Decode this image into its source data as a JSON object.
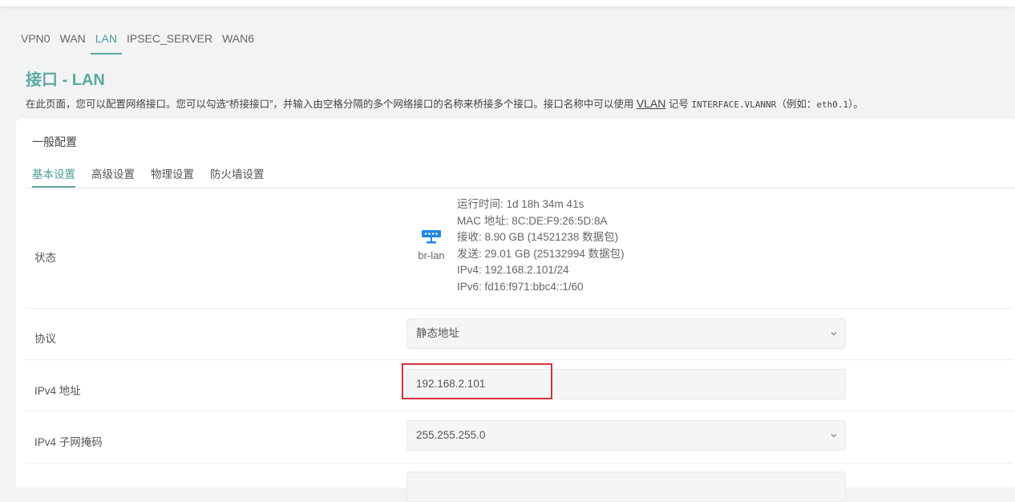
{
  "top_tabs": [
    "VPN0",
    "WAN",
    "LAN",
    "IPSEC_SERVER",
    "WAN6"
  ],
  "active_tab": "LAN",
  "page": {
    "title": "接口 - LAN",
    "desc_part1": "在此页面，您可以配置网络接口。您可以勾选“桥接接口”，并输入由空格分隔的多个网络接口的名称来桥接多个接口。接口名称中可以使用 ",
    "desc_link": "VLAN",
    "desc_part2": " 记号 ",
    "desc_code": "INTERFACE.VLANNR",
    "desc_part3": "（例如：",
    "desc_example": "eth0.1",
    "desc_part4": "）。"
  },
  "section": {
    "title": "一般配置",
    "tabs": [
      "基本设置",
      "高级设置",
      "物理设置",
      "防火墙设置"
    ],
    "active_tab": "基本设置"
  },
  "status": {
    "label": "状态",
    "device_name": "br-lan",
    "device_icon": "network-switch-icon",
    "lines": [
      "运行时间: 1d 18h 34m 41s",
      "MAC 地址: 8C:DE:F9:26:5D:8A",
      "接收: 8.90 GB (14521238 数据包)",
      "发送: 29.01 GB (25132994 数据包)",
      "IPv4: 192.168.2.101/24",
      "IPv6: fd16:f971:bbc4::1/60"
    ]
  },
  "protocol": {
    "label": "协议",
    "value": "静态地址"
  },
  "ipv4_address": {
    "label": "IPv4 地址",
    "value": "192.168.2.101"
  },
  "ipv4_netmask": {
    "label": "IPv4 子网掩码",
    "value": "255.255.255.0"
  },
  "colors": {
    "accent": "#5ba8a2",
    "highlight": "#d6303a",
    "device_icon": "#1e88e5"
  }
}
